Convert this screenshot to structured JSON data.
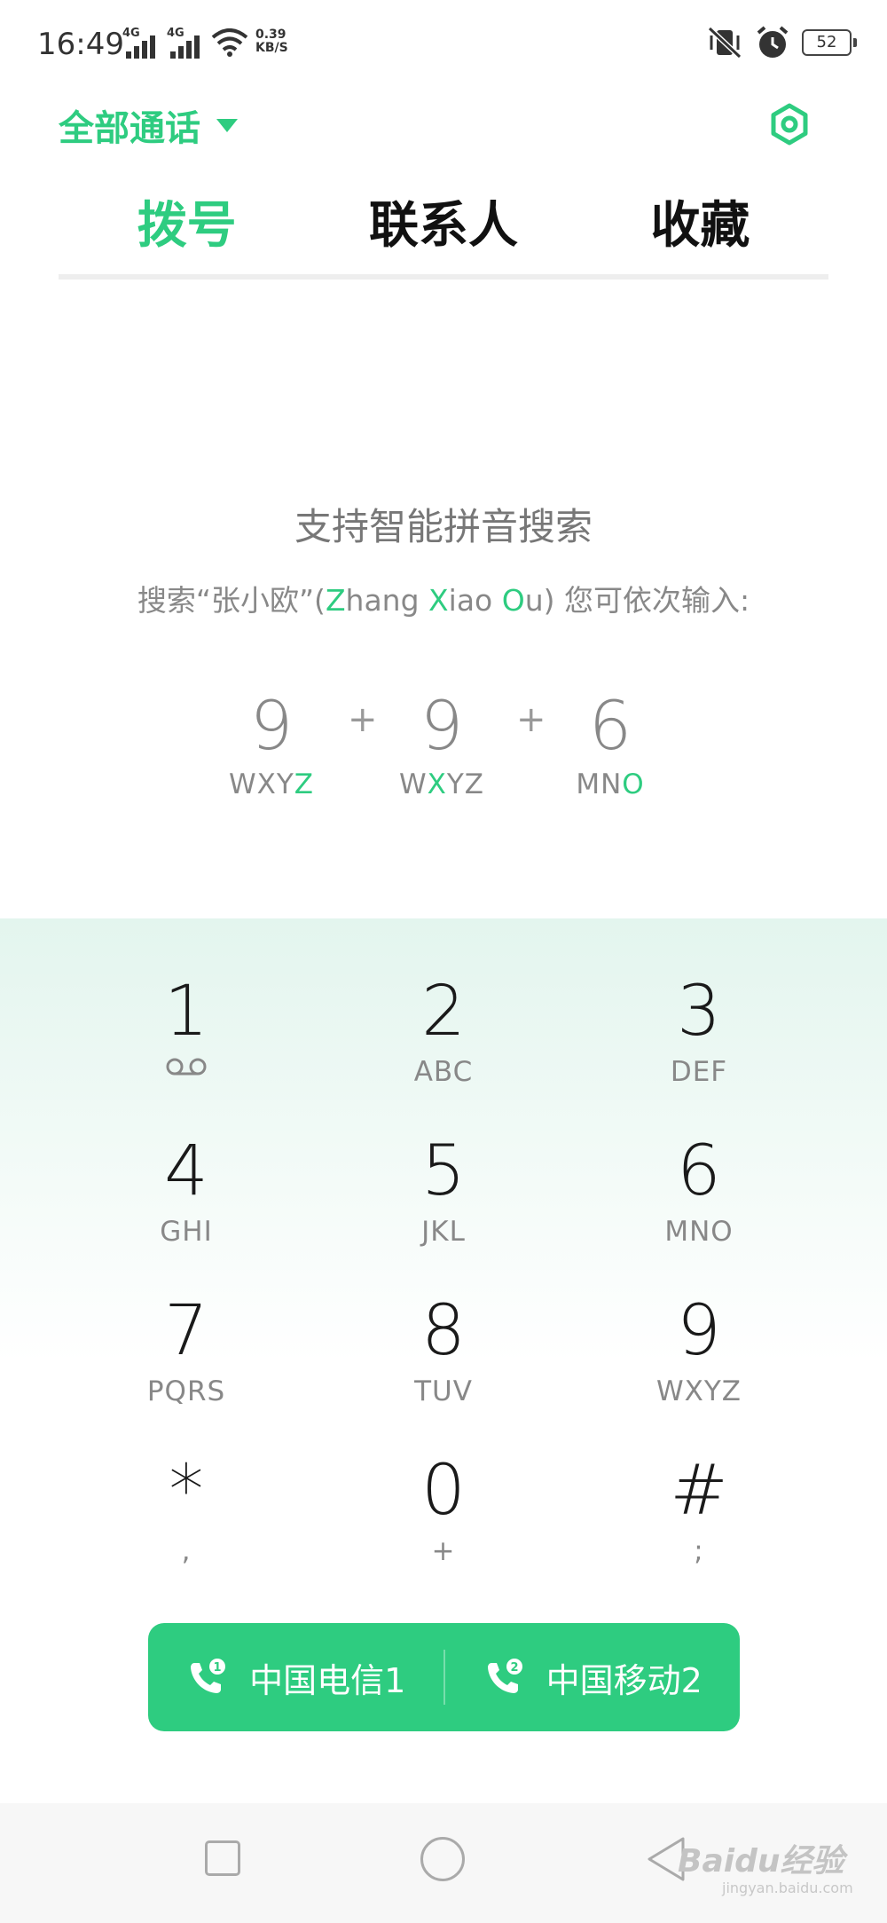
{
  "status_bar": {
    "time": "16:49",
    "sim1_tag": "4G",
    "sim2_tag": "4G",
    "speed_value": "0.39",
    "speed_unit": "KB/S",
    "battery": "52",
    "icons": [
      "signal-icon",
      "wifi-icon",
      "mute-vibrate-icon",
      "alarm-icon",
      "battery-icon"
    ]
  },
  "header": {
    "filter_label": "全部通话",
    "settings_icon": "settings-icon"
  },
  "tabs": [
    {
      "label": "拨号",
      "active": true
    },
    {
      "label": "联系人",
      "active": false
    },
    {
      "label": "收藏",
      "active": false
    }
  ],
  "hint": {
    "title": "支持智能拼音搜索",
    "sub_prefix": "搜索“张小欧”(",
    "z": "Z",
    "hang": "hang ",
    "x": "X",
    "iao": "iao ",
    "o": "O",
    "u": "u",
    "sub_suffix": ") 您可依次输入:"
  },
  "example": {
    "keys": [
      {
        "digit": "9",
        "letters_pre": "WXY",
        "letters_hl": "Z",
        "letters_post": ""
      },
      {
        "digit": "9",
        "letters_pre": "W",
        "letters_hl": "X",
        "letters_post": "YZ"
      },
      {
        "digit": "6",
        "letters_pre": "MN",
        "letters_hl": "O",
        "letters_post": ""
      }
    ],
    "plus": "+"
  },
  "dialpad": {
    "keys": [
      {
        "digit": "1",
        "sub": ""
      },
      {
        "digit": "2",
        "sub": "ABC"
      },
      {
        "digit": "3",
        "sub": "DEF"
      },
      {
        "digit": "4",
        "sub": "GHI"
      },
      {
        "digit": "5",
        "sub": "JKL"
      },
      {
        "digit": "6",
        "sub": "MNO"
      },
      {
        "digit": "7",
        "sub": "PQRS"
      },
      {
        "digit": "8",
        "sub": "TUV"
      },
      {
        "digit": "9",
        "sub": "WXYZ"
      },
      {
        "digit": "*",
        "sub": ","
      },
      {
        "digit": "0",
        "sub": "+"
      },
      {
        "digit": "#",
        "sub": ";"
      }
    ]
  },
  "call_buttons": [
    {
      "label": "中国电信1",
      "sim": "1"
    },
    {
      "label": "中国移动2",
      "sim": "2"
    }
  ],
  "watermark": {
    "brand": "Baidu经验",
    "url": "jingyan.baidu.com"
  },
  "colors": {
    "accent": "#2ecc80"
  }
}
